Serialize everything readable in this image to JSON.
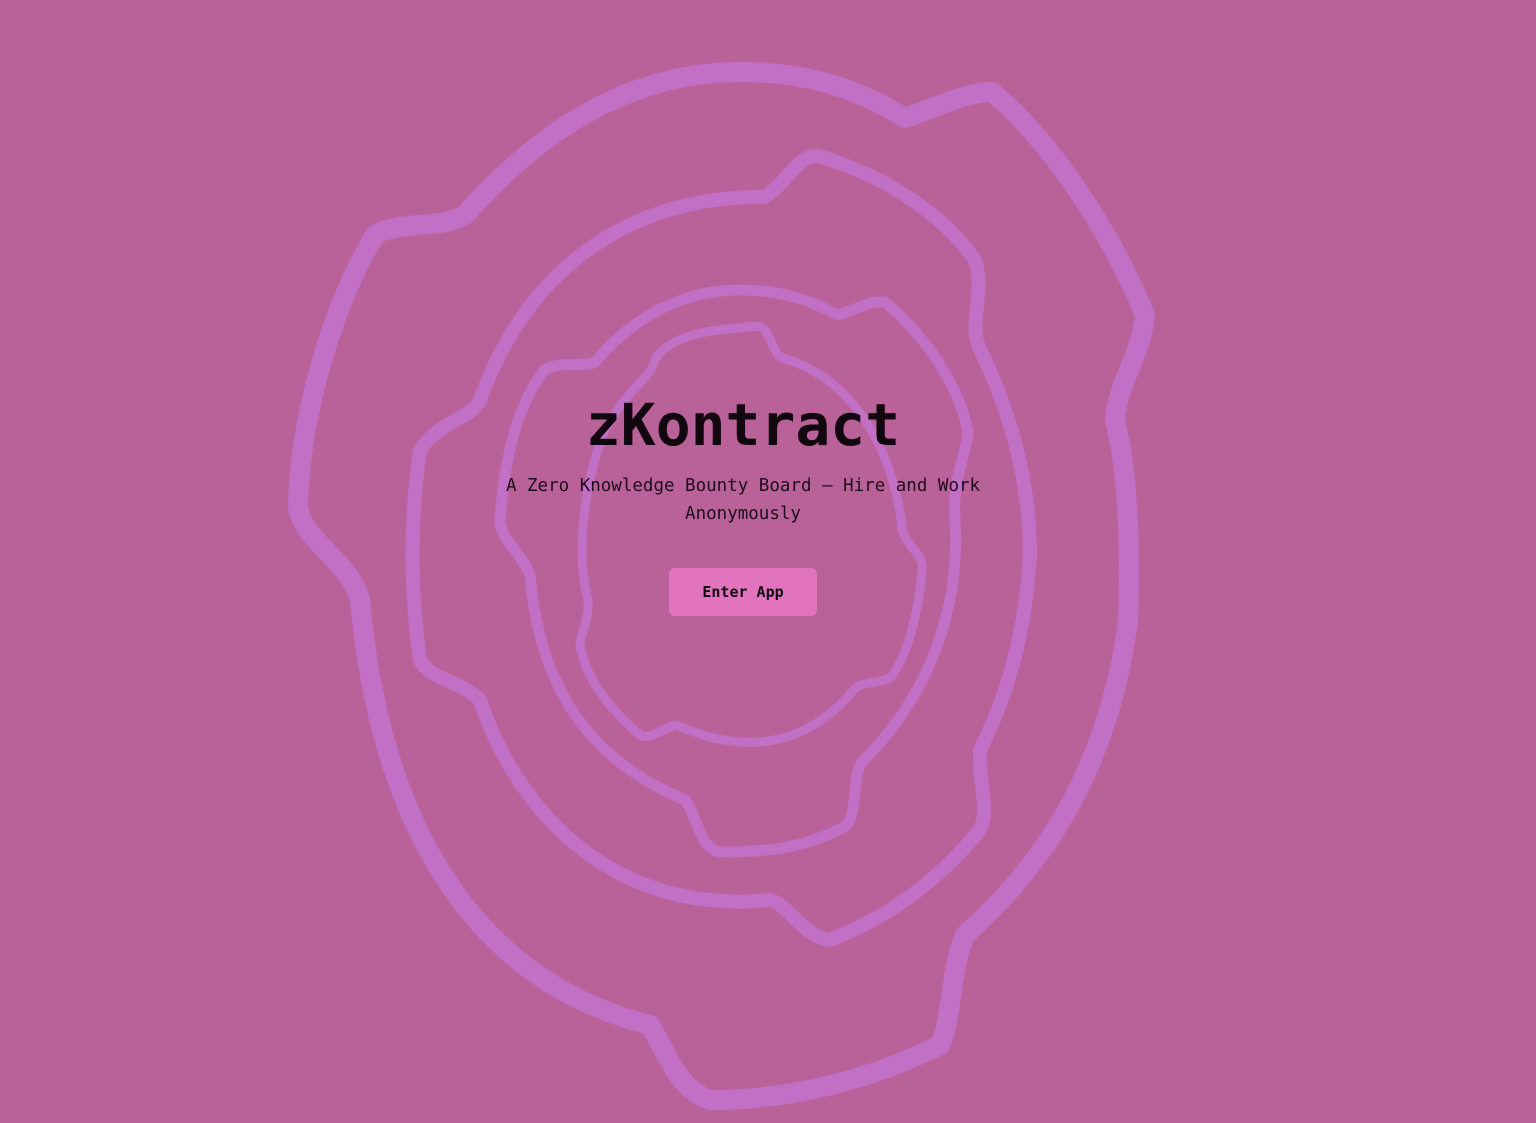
{
  "hero": {
    "title": "zKontract",
    "tagline": "A Zero Knowledge Bounty Board — Hire and Work Anonymously",
    "cta_label": "Enter App"
  },
  "colors": {
    "background": "#b86299",
    "ring_stroke": "#c26fc6",
    "button": "#e173bf",
    "text": "#12070f"
  }
}
